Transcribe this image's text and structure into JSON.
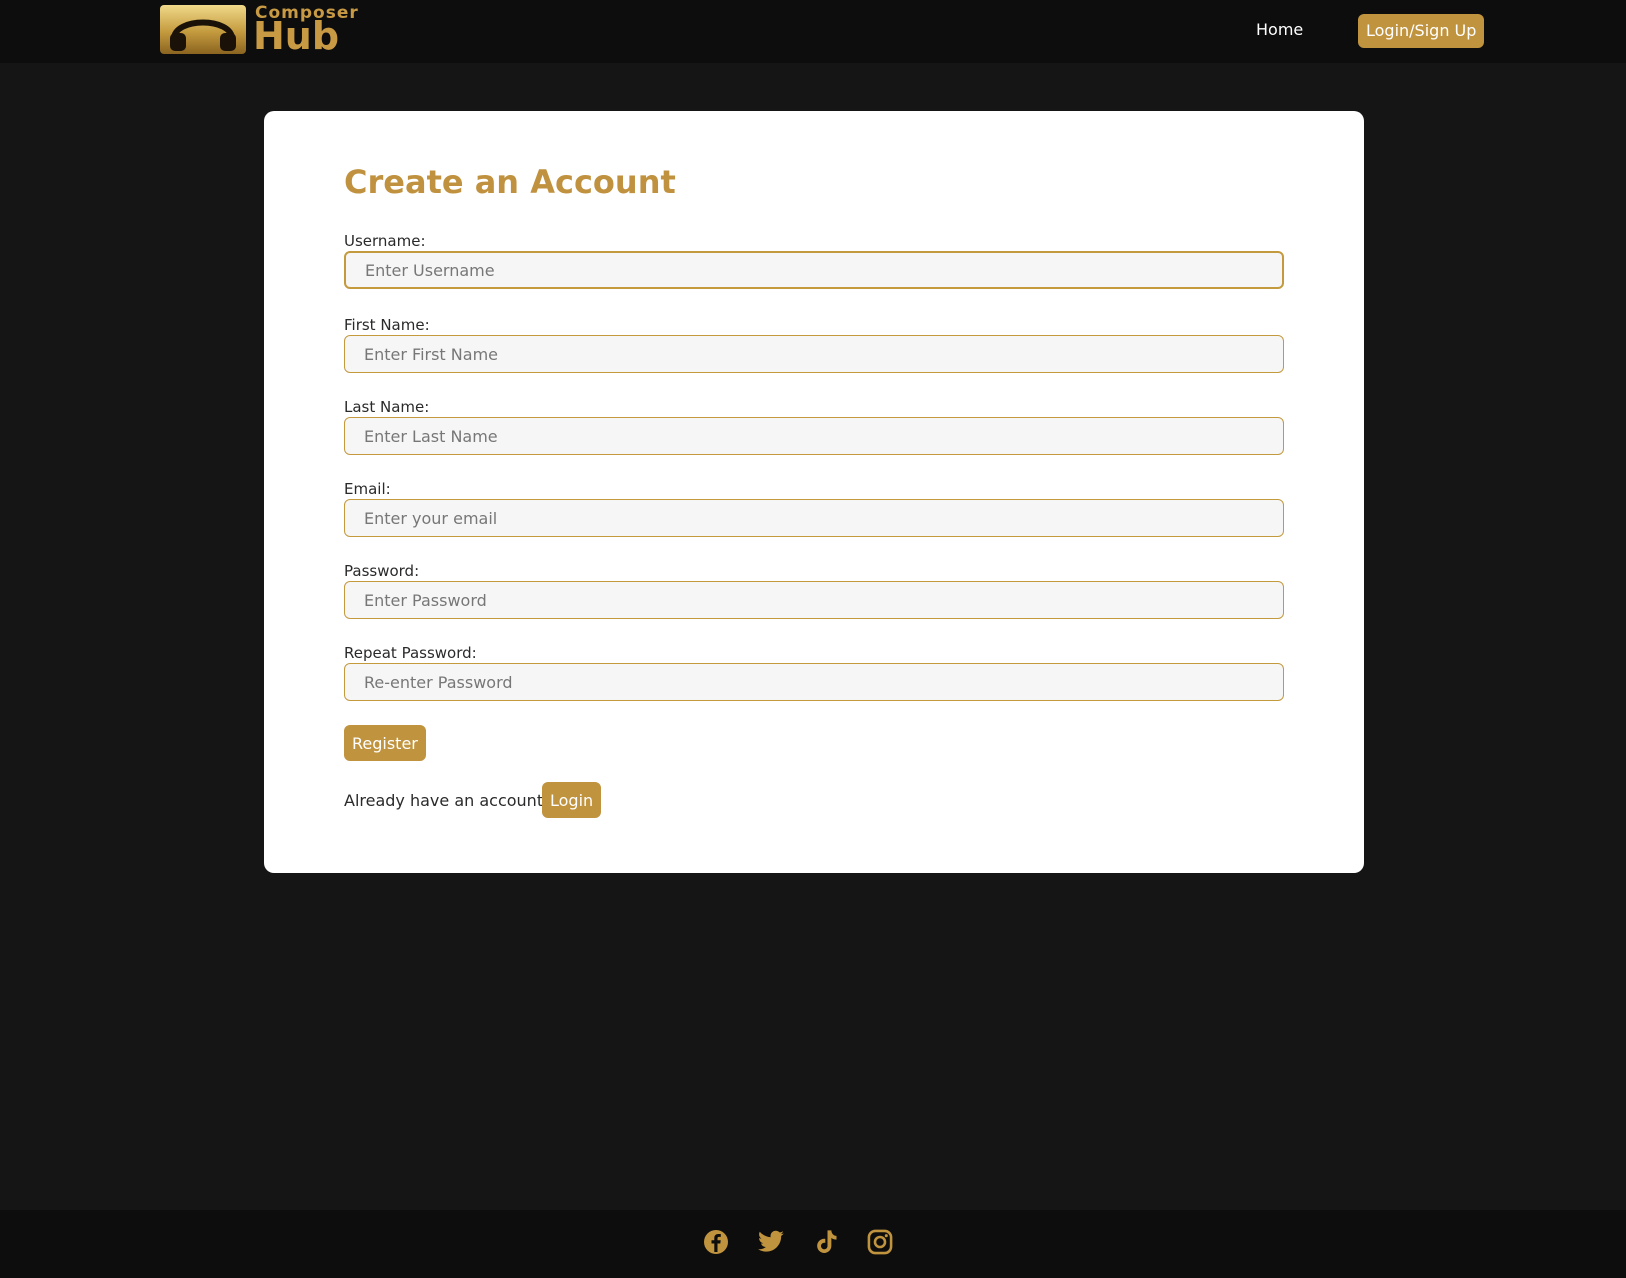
{
  "brand": {
    "logo_top": "Composer",
    "logo_bottom": "Hub"
  },
  "nav": {
    "home": "Home",
    "login_signup": "Login/Sign Up"
  },
  "form": {
    "title": "Create an Account",
    "fields": [
      {
        "label": "Username:",
        "placeholder": "Enter Username"
      },
      {
        "label": "First Name:",
        "placeholder": "Enter First Name"
      },
      {
        "label": "Last Name:",
        "placeholder": "Enter Last Name"
      },
      {
        "label": "Email:",
        "placeholder": "Enter your email"
      },
      {
        "label": "Password:",
        "placeholder": "Enter Password"
      },
      {
        "label": "Repeat Password:",
        "placeholder": "Re-enter Password"
      }
    ],
    "register_label": "Register",
    "already_text": "Already have an account?",
    "login_label": "Login"
  },
  "footer": {
    "icons": [
      "facebook-icon",
      "twitter-icon",
      "tiktok-icon",
      "instagram-icon"
    ]
  },
  "colors": {
    "accent": "#c0933e",
    "background": "#151515",
    "navbar": "#0d0d0d",
    "card": "#ffffff"
  }
}
